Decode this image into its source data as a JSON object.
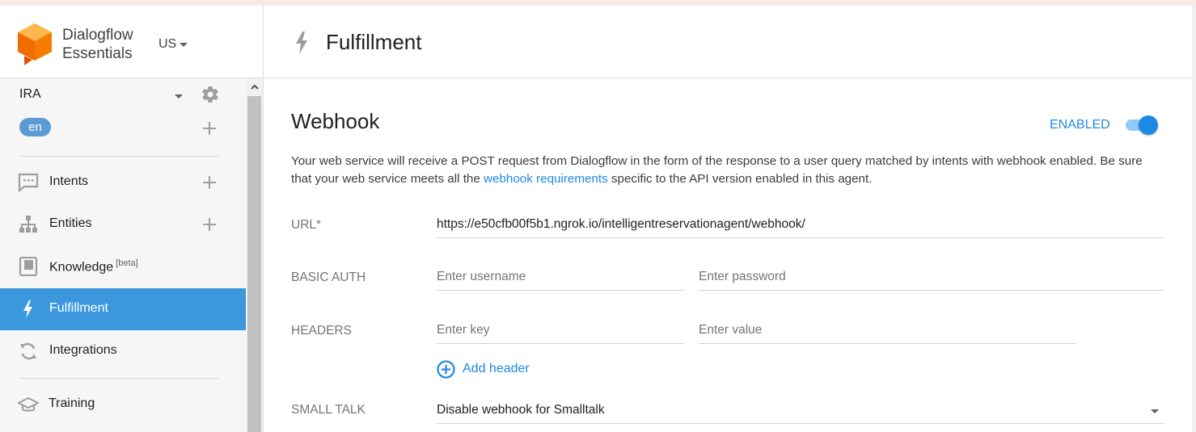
{
  "brand": {
    "name_line1": "Dialogflow",
    "name_line2": "Essentials",
    "region": "US"
  },
  "agent": {
    "name": "IRA",
    "language": "en"
  },
  "nav": {
    "items": [
      {
        "label": "Intents",
        "icon": "chat-icon",
        "has_add": true,
        "active": false
      },
      {
        "label": "Entities",
        "icon": "hierarchy-icon",
        "has_add": true,
        "active": false
      },
      {
        "label": "Knowledge",
        "badge": "[beta]",
        "icon": "book-icon",
        "has_add": false,
        "active": false
      },
      {
        "label": "Fulfillment",
        "icon": "bolt-icon",
        "has_add": false,
        "active": true
      },
      {
        "label": "Integrations",
        "icon": "sync-icon",
        "has_add": false,
        "active": false
      },
      {
        "label": "Training",
        "icon": "graduation-cap-icon",
        "has_add": false,
        "active": false
      }
    ]
  },
  "page": {
    "title": "Fulfillment"
  },
  "webhook": {
    "title": "Webhook",
    "enabled_label": "ENABLED",
    "enabled": true,
    "description_before": "Your web service will receive a POST request from Dialogflow in the form of the response to a user query matched by intents with webhook enabled. Be sure that your web service meets all the ",
    "description_link": "webhook requirements",
    "description_after": " specific to the API version enabled in this agent.",
    "url_label": "URL*",
    "url_value": "https://e50cfb00f5b1.ngrok.io/intelligentreservationagent/webhook/",
    "basic_auth_label": "BASIC AUTH",
    "username_placeholder": "Enter username",
    "password_placeholder": "Enter password",
    "headers_label": "HEADERS",
    "key_placeholder": "Enter key",
    "value_placeholder": "Enter value",
    "add_header_label": "Add header",
    "small_talk_label": "SMALL TALK",
    "small_talk_value": "Disable webhook for Smalltalk"
  },
  "colors": {
    "accent": "#1e88e5",
    "active_nav": "#3c98dd",
    "logo_orange": "#ef6c00"
  }
}
